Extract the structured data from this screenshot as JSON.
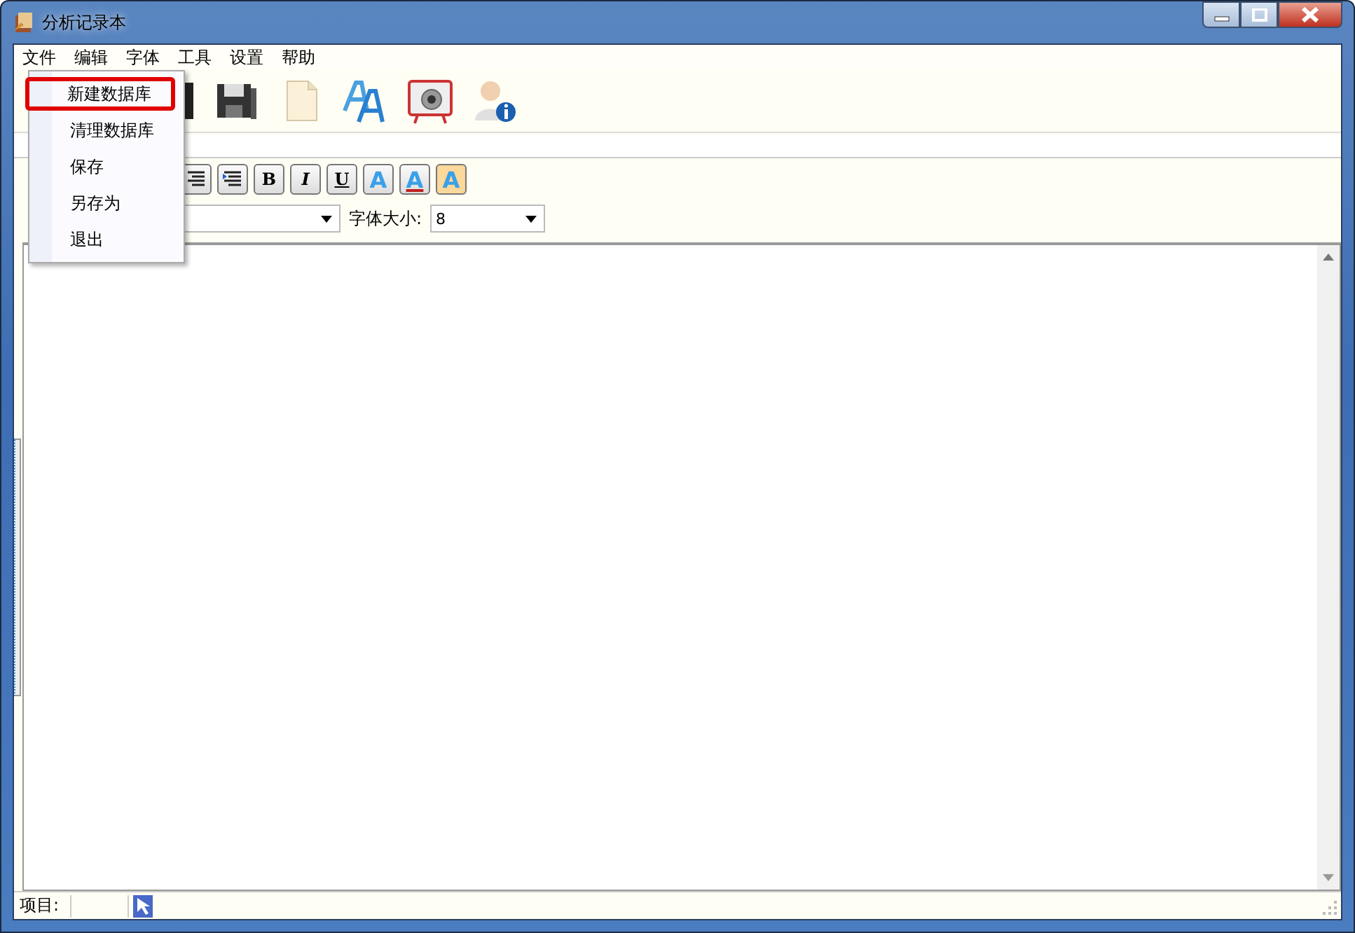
{
  "window": {
    "title": "分析记录本"
  },
  "menu_bar": [
    {
      "label": "文件"
    },
    {
      "label": "编辑"
    },
    {
      "label": "字体"
    },
    {
      "label": "工具"
    },
    {
      "label": "设置"
    },
    {
      "label": "帮助"
    }
  ],
  "file_menu": {
    "items": [
      {
        "label": "新建数据库",
        "highlighted": true
      },
      {
        "label": "清理数据库",
        "highlighted": false
      },
      {
        "label": "保存",
        "highlighted": false
      },
      {
        "label": "另存为",
        "highlighted": false
      },
      {
        "label": "退出",
        "highlighted": false
      }
    ]
  },
  "format_toolbar": {
    "buttons": [
      {
        "kind": "align"
      },
      {
        "kind": "indent"
      },
      {
        "kind": "bold",
        "label": "B"
      },
      {
        "kind": "italic",
        "label": "I"
      },
      {
        "kind": "underline",
        "label": "U"
      },
      {
        "kind": "font",
        "label": "A"
      },
      {
        "kind": "font-color",
        "label": "A"
      },
      {
        "kind": "highlight",
        "label": "A"
      }
    ]
  },
  "font_size": {
    "label": "字体大小:",
    "value": "8"
  },
  "status_bar": {
    "label": "项目:"
  }
}
